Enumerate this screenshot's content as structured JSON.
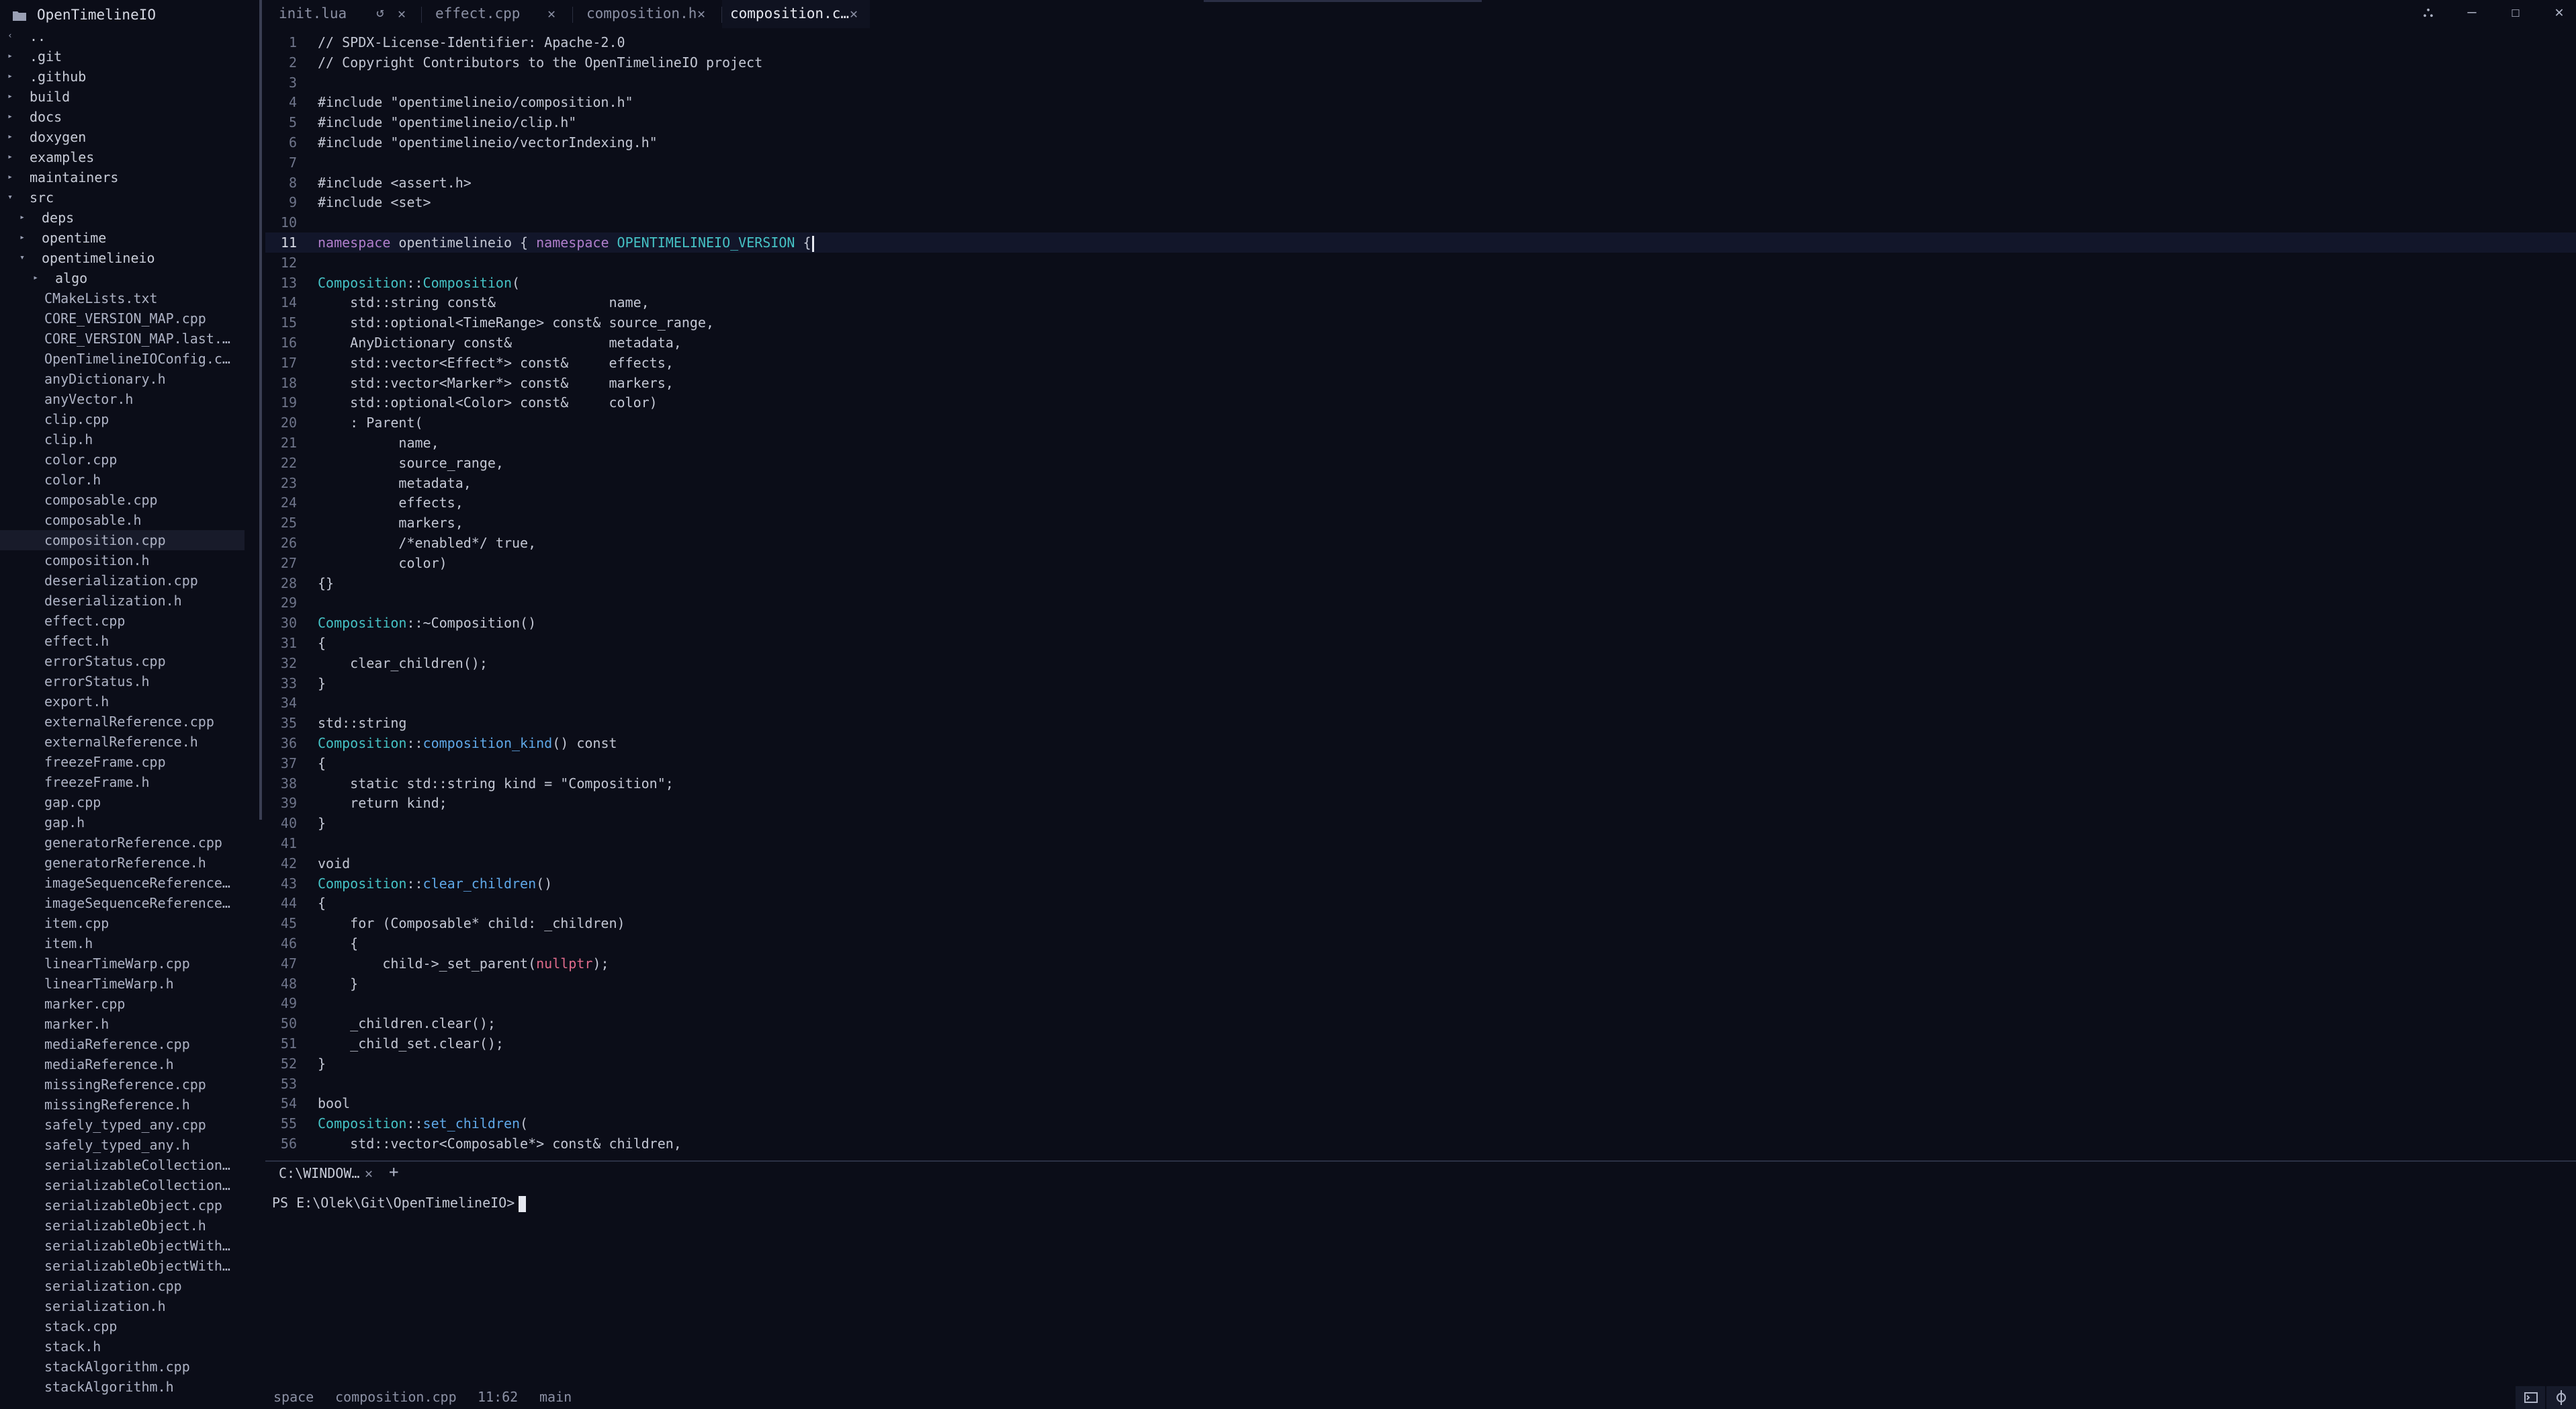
{
  "sidebar": {
    "title": "OpenTimelineIO",
    "tree": [
      {
        "label": "..",
        "depth": 0,
        "type": "dir",
        "arrow": "‹"
      },
      {
        "label": ".git",
        "depth": 0,
        "type": "dir",
        "arrow": "▸"
      },
      {
        "label": ".github",
        "depth": 0,
        "type": "dir",
        "arrow": "▸"
      },
      {
        "label": "build",
        "depth": 0,
        "type": "dir",
        "arrow": "▸"
      },
      {
        "label": "docs",
        "depth": 0,
        "type": "dir",
        "arrow": "▸"
      },
      {
        "label": "doxygen",
        "depth": 0,
        "type": "dir",
        "arrow": "▸"
      },
      {
        "label": "examples",
        "depth": 0,
        "type": "dir",
        "arrow": "▸"
      },
      {
        "label": "maintainers",
        "depth": 0,
        "type": "dir",
        "arrow": "▸"
      },
      {
        "label": "src",
        "depth": 0,
        "type": "dir",
        "arrow": "▾"
      },
      {
        "label": "deps",
        "depth": 1,
        "type": "dir",
        "arrow": "▸"
      },
      {
        "label": "opentime",
        "depth": 1,
        "type": "dir",
        "arrow": "▸"
      },
      {
        "label": "opentimelineio",
        "depth": 1,
        "type": "dir",
        "arrow": "▾"
      },
      {
        "label": "algo",
        "depth": 2,
        "type": "dir",
        "arrow": "▸"
      },
      {
        "label": "CMakeLists.txt",
        "depth": 2,
        "type": "file"
      },
      {
        "label": "CORE_VERSION_MAP.cpp",
        "depth": 2,
        "type": "file"
      },
      {
        "label": "CORE_VERSION_MAP.last.…",
        "depth": 2,
        "type": "file"
      },
      {
        "label": "OpenTimelineIOConfig.c…",
        "depth": 2,
        "type": "file"
      },
      {
        "label": "anyDictionary.h",
        "depth": 2,
        "type": "file"
      },
      {
        "label": "anyVector.h",
        "depth": 2,
        "type": "file"
      },
      {
        "label": "clip.cpp",
        "depth": 2,
        "type": "file"
      },
      {
        "label": "clip.h",
        "depth": 2,
        "type": "file"
      },
      {
        "label": "color.cpp",
        "depth": 2,
        "type": "file"
      },
      {
        "label": "color.h",
        "depth": 2,
        "type": "file"
      },
      {
        "label": "composable.cpp",
        "depth": 2,
        "type": "file"
      },
      {
        "label": "composable.h",
        "depth": 2,
        "type": "file"
      },
      {
        "label": "composition.cpp",
        "depth": 2,
        "type": "file",
        "selected": true
      },
      {
        "label": "composition.h",
        "depth": 2,
        "type": "file"
      },
      {
        "label": "deserialization.cpp",
        "depth": 2,
        "type": "file"
      },
      {
        "label": "deserialization.h",
        "depth": 2,
        "type": "file"
      },
      {
        "label": "effect.cpp",
        "depth": 2,
        "type": "file"
      },
      {
        "label": "effect.h",
        "depth": 2,
        "type": "file"
      },
      {
        "label": "errorStatus.cpp",
        "depth": 2,
        "type": "file"
      },
      {
        "label": "errorStatus.h",
        "depth": 2,
        "type": "file"
      },
      {
        "label": "export.h",
        "depth": 2,
        "type": "file"
      },
      {
        "label": "externalReference.cpp",
        "depth": 2,
        "type": "file"
      },
      {
        "label": "externalReference.h",
        "depth": 2,
        "type": "file"
      },
      {
        "label": "freezeFrame.cpp",
        "depth": 2,
        "type": "file"
      },
      {
        "label": "freezeFrame.h",
        "depth": 2,
        "type": "file"
      },
      {
        "label": "gap.cpp",
        "depth": 2,
        "type": "file"
      },
      {
        "label": "gap.h",
        "depth": 2,
        "type": "file"
      },
      {
        "label": "generatorReference.cpp",
        "depth": 2,
        "type": "file"
      },
      {
        "label": "generatorReference.h",
        "depth": 2,
        "type": "file"
      },
      {
        "label": "imageSequenceReference…",
        "depth": 2,
        "type": "file"
      },
      {
        "label": "imageSequenceReference…",
        "depth": 2,
        "type": "file"
      },
      {
        "label": "item.cpp",
        "depth": 2,
        "type": "file"
      },
      {
        "label": "item.h",
        "depth": 2,
        "type": "file"
      },
      {
        "label": "linearTimeWarp.cpp",
        "depth": 2,
        "type": "file"
      },
      {
        "label": "linearTimeWarp.h",
        "depth": 2,
        "type": "file"
      },
      {
        "label": "marker.cpp",
        "depth": 2,
        "type": "file"
      },
      {
        "label": "marker.h",
        "depth": 2,
        "type": "file"
      },
      {
        "label": "mediaReference.cpp",
        "depth": 2,
        "type": "file"
      },
      {
        "label": "mediaReference.h",
        "depth": 2,
        "type": "file"
      },
      {
        "label": "missingReference.cpp",
        "depth": 2,
        "type": "file"
      },
      {
        "label": "missingReference.h",
        "depth": 2,
        "type": "file"
      },
      {
        "label": "safely_typed_any.cpp",
        "depth": 2,
        "type": "file"
      },
      {
        "label": "safely_typed_any.h",
        "depth": 2,
        "type": "file"
      },
      {
        "label": "serializableCollection…",
        "depth": 2,
        "type": "file"
      },
      {
        "label": "serializableCollection…",
        "depth": 2,
        "type": "file"
      },
      {
        "label": "serializableObject.cpp",
        "depth": 2,
        "type": "file"
      },
      {
        "label": "serializableObject.h",
        "depth": 2,
        "type": "file"
      },
      {
        "label": "serializableObjectWith…",
        "depth": 2,
        "type": "file"
      },
      {
        "label": "serializableObjectWith…",
        "depth": 2,
        "type": "file"
      },
      {
        "label": "serialization.cpp",
        "depth": 2,
        "type": "file"
      },
      {
        "label": "serialization.h",
        "depth": 2,
        "type": "file"
      },
      {
        "label": "stack.cpp",
        "depth": 2,
        "type": "file"
      },
      {
        "label": "stack.h",
        "depth": 2,
        "type": "file"
      },
      {
        "label": "stackAlgorithm.cpp",
        "depth": 2,
        "type": "file"
      },
      {
        "label": "stackAlgorithm.h",
        "depth": 2,
        "type": "file"
      }
    ]
  },
  "tabs": [
    {
      "label": "init.lua",
      "active": false,
      "reload": true
    },
    {
      "label": "effect.cpp",
      "active": false
    },
    {
      "label": "composition.h",
      "active": false
    },
    {
      "label": "composition.c…",
      "active": true
    }
  ],
  "window_controls": {
    "layout": "⛬",
    "minimize": "–",
    "maximize": "☐",
    "close": "✕"
  },
  "editor": {
    "current_line": 11,
    "lines": [
      [
        [
          "// SPDX-License-Identifier: Apache-2.0",
          ""
        ]
      ],
      [
        [
          "// Copyright Contributors to the OpenTimelineIO project",
          ""
        ]
      ],
      [],
      [
        [
          "#include \"opentimelineio/composition.h\"",
          ""
        ]
      ],
      [
        [
          "#include \"opentimelineio/clip.h\"",
          ""
        ]
      ],
      [
        [
          "#include \"opentimelineio/vectorIndexing.h\"",
          ""
        ]
      ],
      [],
      [
        [
          "#include <assert.h>",
          ""
        ]
      ],
      [
        [
          "#include <set>",
          ""
        ]
      ],
      [],
      [
        [
          "namespace",
          "k"
        ],
        [
          " opentimelineio { ",
          ""
        ],
        [
          "namespace",
          "k"
        ],
        [
          " ",
          ""
        ],
        [
          "OPENTIMELINEIO_VERSION",
          "t"
        ],
        [
          " {",
          ""
        ]
      ],
      [],
      [
        [
          "Composition",
          "t"
        ],
        [
          "::",
          ""
        ],
        [
          "Composition",
          "t"
        ],
        [
          "(",
          ""
        ]
      ],
      [
        [
          "    std::string const&              name,",
          ""
        ]
      ],
      [
        [
          "    std::optional<TimeRange> const& source_range,",
          ""
        ]
      ],
      [
        [
          "    AnyDictionary const&            metadata,",
          ""
        ]
      ],
      [
        [
          "    std::vector<Effect*> const&     effects,",
          ""
        ]
      ],
      [
        [
          "    std::vector<Marker*> const&     markers,",
          ""
        ]
      ],
      [
        [
          "    std::optional<Color> const&     color)",
          ""
        ]
      ],
      [
        [
          "    : Parent(",
          ""
        ]
      ],
      [
        [
          "          name,",
          ""
        ]
      ],
      [
        [
          "          source_range,",
          ""
        ]
      ],
      [
        [
          "          metadata,",
          ""
        ]
      ],
      [
        [
          "          effects,",
          ""
        ]
      ],
      [
        [
          "          markers,",
          ""
        ]
      ],
      [
        [
          "          /*enabled*/ true,",
          ""
        ]
      ],
      [
        [
          "          color)",
          ""
        ]
      ],
      [
        [
          "{}",
          ""
        ]
      ],
      [],
      [
        [
          "Composition",
          "t"
        ],
        [
          "::~Composition()",
          ""
        ]
      ],
      [
        [
          "{",
          ""
        ]
      ],
      [
        [
          "    clear_children();",
          ""
        ]
      ],
      [
        [
          "}",
          ""
        ]
      ],
      [],
      [
        [
          "std::string",
          ""
        ]
      ],
      [
        [
          "Composition",
          "t"
        ],
        [
          "::",
          ""
        ],
        [
          "composition_kind",
          "f"
        ],
        [
          "() const",
          ""
        ]
      ],
      [
        [
          "{",
          ""
        ]
      ],
      [
        [
          "    static std::string kind = \"Composition\";",
          ""
        ]
      ],
      [
        [
          "    return kind;",
          ""
        ]
      ],
      [
        [
          "}",
          ""
        ]
      ],
      [],
      [
        [
          "void",
          ""
        ]
      ],
      [
        [
          "Composition",
          "t"
        ],
        [
          "::",
          ""
        ],
        [
          "clear_children",
          "f"
        ],
        [
          "()",
          ""
        ]
      ],
      [
        [
          "{",
          ""
        ]
      ],
      [
        [
          "    for (Composable* child: _children)",
          ""
        ]
      ],
      [
        [
          "    {",
          ""
        ]
      ],
      [
        [
          "        child->_set_parent(",
          ""
        ],
        [
          "nullptr",
          "r"
        ],
        [
          ");",
          ""
        ]
      ],
      [
        [
          "    }",
          ""
        ]
      ],
      [],
      [
        [
          "    _children.clear();",
          ""
        ]
      ],
      [
        [
          "    _child_set.clear();",
          ""
        ]
      ],
      [
        [
          "}",
          ""
        ]
      ],
      [],
      [
        [
          "bool",
          ""
        ]
      ],
      [
        [
          "Composition",
          "t"
        ],
        [
          "::",
          ""
        ],
        [
          "set_children",
          "f"
        ],
        [
          "(",
          ""
        ]
      ],
      [
        [
          "    std::vector<Composable*> const& children,",
          ""
        ]
      ]
    ]
  },
  "terminal": {
    "tab_label": "C:\\WINDOW…",
    "close": "✕",
    "add": "+",
    "prompt": "PS E:\\Olek\\Git\\OpenTimelineIO>"
  },
  "statusbar": {
    "indent": "space",
    "file": "composition.cpp",
    "position": "11:62",
    "branch": "main"
  }
}
